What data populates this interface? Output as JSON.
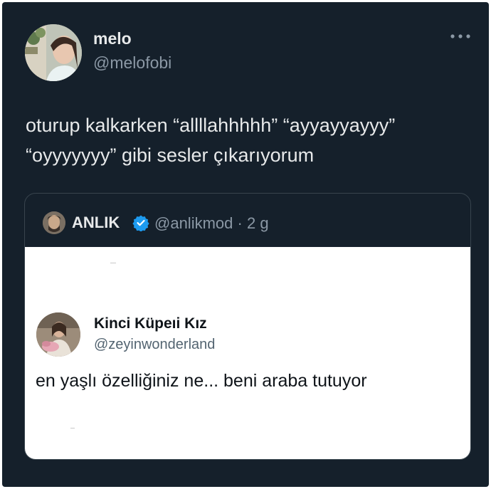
{
  "tweet": {
    "display_name": "melo",
    "handle": "@melofobi",
    "text_lines": [
      "oturup kalkarken “allllahhhhh” “ayyayyayyy”",
      "“oyyyyyyy” gibi sesler çıkarıyorum"
    ],
    "more_icon": "more-horizontal-icon"
  },
  "quote": {
    "display_name": "ANLIK",
    "verified_icon": "verified-badge-icon",
    "handle": "@anlikmod",
    "separator": "·",
    "time": "2 g",
    "image": {
      "display_name": "Kinci Küpeıi Kız",
      "handle": "@zeyinwonderland",
      "text": "en yaşlı özelliğiniz ne... beni araba tutuyor"
    }
  },
  "colors": {
    "background": "#15202b",
    "primary_text": "#e7e9ea",
    "secondary_text": "#8b98a5",
    "border": "#38444d",
    "verified": "#1d9bf0"
  }
}
